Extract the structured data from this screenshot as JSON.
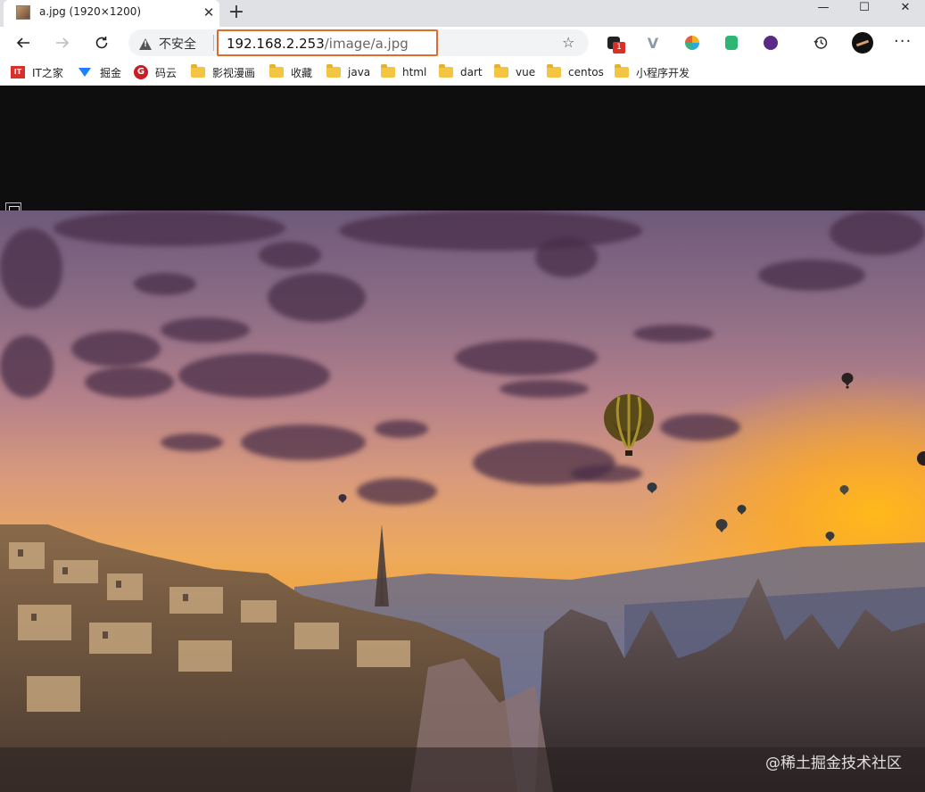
{
  "window": {
    "tab_title": "a.jpg (1920×1200)",
    "tab_close": "✕",
    "new_tab": "+",
    "controls": {
      "minimize": "—",
      "maximize": "☐",
      "close": "✕"
    }
  },
  "toolbar": {
    "back": "back-arrow-icon",
    "forward": "forward-arrow-icon",
    "reload": "reload-icon",
    "security_label": "不安全",
    "url_host": "192.168.2.253",
    "url_path": "/image/a.jpg",
    "extension_badge": "1",
    "favorite_icon": "star-plus-icon",
    "history_icon": "history-icon",
    "more": "···"
  },
  "bookmarks": [
    {
      "label": "IT之家",
      "icon": "ithome-icon"
    },
    {
      "label": "掘金",
      "icon": "juejin-icon"
    },
    {
      "label": "码云",
      "icon": "gitee-icon"
    },
    {
      "label": "影视漫画",
      "icon": "folder-icon"
    },
    {
      "label": "收藏",
      "icon": "folder-icon"
    },
    {
      "label": "java",
      "icon": "folder-icon"
    },
    {
      "label": "html",
      "icon": "folder-icon"
    },
    {
      "label": "dart",
      "icon": "folder-icon"
    },
    {
      "label": "vue",
      "icon": "folder-icon"
    },
    {
      "label": "centos",
      "icon": "folder-icon"
    },
    {
      "label": "小程序开发",
      "icon": "folder-icon"
    }
  ],
  "viewer": {
    "watermark": "@稀土掘金技术社区"
  },
  "colors": {
    "url_highlight": "#e06a2a",
    "tabbar": "#dfe1e5",
    "viewer_bg": "#0e0e0e"
  }
}
